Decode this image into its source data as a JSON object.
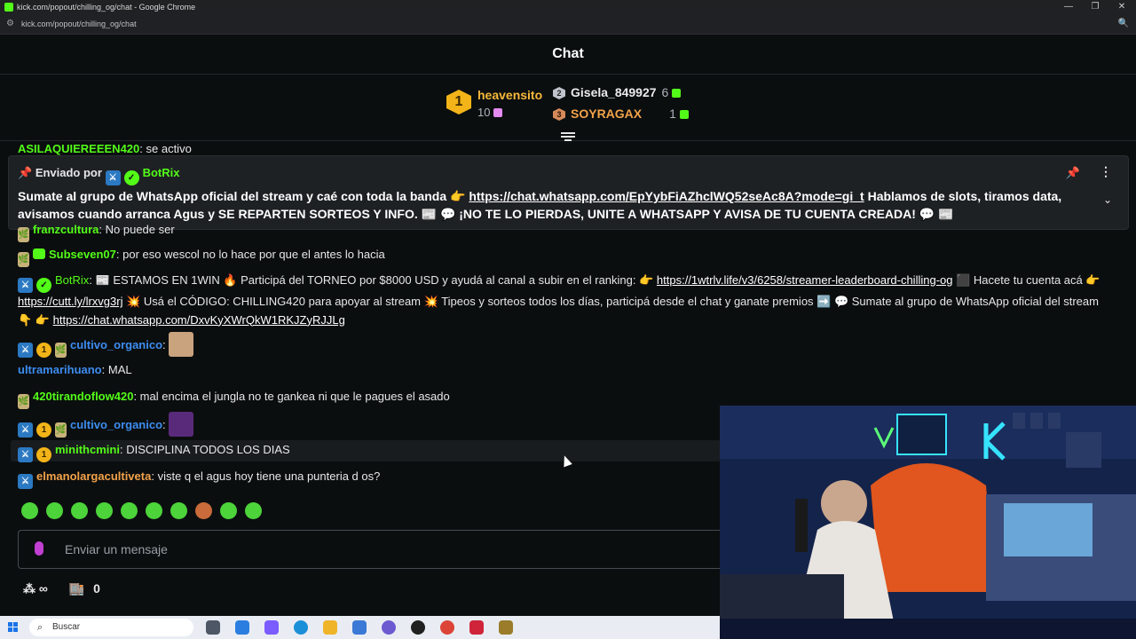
{
  "browser": {
    "window_title": "kick.com/popout/chilling_og/chat - Google Chrome",
    "url": "kick.com/popout/chilling_og/chat"
  },
  "chat": {
    "title": "Chat",
    "leaderboard": [
      {
        "rank": "1",
        "name": "heavensito",
        "count": "10"
      },
      {
        "rank": "2",
        "name": "Gisela_849927",
        "count": "6"
      },
      {
        "rank": "3",
        "name": "SOYRAGAX",
        "count": "1"
      }
    ],
    "cutoff_message": {
      "user": "ASILAQUIEREEEN420",
      "text": "se activo"
    },
    "pinned": {
      "sent_by_label": "Enviado por",
      "bot_name": "BotRix",
      "text_before_link": "Sumate al grupo de WhatsApp oficial del stream y caé con toda la banda 👉 ",
      "link": "https://chat.whatsapp.com/EpYybFiAZhclWQ52seAc8A?mode=gi_t",
      "text_after_link": " Hablamos de slots, tiramos data, avisamos cuando arranca Agus y SE REPARTEN SORTEOS Y INFO. 📰 💬 ¡NO TE LO PIERDAS, UNITE A WHATSAPP Y AVISA DE TU CUENTA CREADA! 💬 📰"
    },
    "messages": [
      {
        "user": "franzcultura",
        "text": "No puede ser",
        "color": "#53fc18"
      },
      {
        "user": "Subseven07",
        "text": "por eso wescol no lo hace por que el antes lo hacia",
        "color": "#53fc18"
      },
      {
        "user": "cultivo_organico",
        "text": "",
        "color": "#3d8df0"
      },
      {
        "user": "ultramarihuano",
        "text": "MAL",
        "color": "#3d8df0"
      },
      {
        "user": "420tirandoflow420",
        "text": "mal encima el jungla no te gankea ni que le pagues el asado",
        "color": "#53fc18"
      },
      {
        "user": "cultivo_organico",
        "text": "",
        "color": "#3d8df0"
      },
      {
        "user": "minithcmini",
        "text": "DISCIPLINA TODOS LOS DIAS",
        "color": "#53fc18"
      },
      {
        "user": "elmanolargacultiveta",
        "text": "viste q el agus hoy tiene una punteria d os?",
        "color": "#f2a24a"
      }
    ],
    "bot_message": {
      "user": "BotRix",
      "seg1": "📰 ESTAMOS EN 1WIN 🔥 Participá del TORNEO por $8000 USD y ayudá al canal a subir en el ranking: 👉 ",
      "link1": "https://1wtrlv.life/v3/6258/streamer-leaderboard-chilling-og",
      "seg2": " ⬛ Hacete tu cuenta acá 👉 ",
      "link2": "https://cutt.ly/lrxvg3rj",
      "seg3": " 💥 Usá el CÓDIGO: CHILLING420 para apoyar al stream 💥 Tipeos y sorteos todos los días, participá desde el chat y ganate premios ➡️ 💬 Sumate al grupo de WhatsApp oficial del stream 👇 👉 ",
      "link3": "https://chat.whatsapp.com/DxvKyXWrQkW1RKJZyRJJLg"
    },
    "input_placeholder": "Enviar un mensaje",
    "footer": {
      "points": "∞",
      "store_count": "0"
    }
  },
  "taskbar": {
    "search_label": "Buscar"
  },
  "colors": {
    "accent": "#53fc18",
    "background": "#0b0e0f",
    "gold": "#f2b418"
  }
}
